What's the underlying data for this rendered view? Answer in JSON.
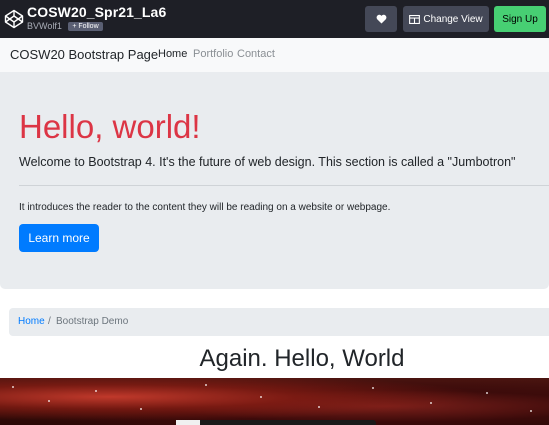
{
  "codepen": {
    "title": "COSW20_Spr21_La6",
    "username": "BVWolf1",
    "follow_label": "+ Follow",
    "change_view_label": "Change View",
    "signup_label": "Sign Up"
  },
  "navbar": {
    "brand": "COSW20 Bootstrap Page",
    "links": [
      {
        "label": "Home"
      },
      {
        "label": "Portfolio"
      },
      {
        "label": "Contact"
      }
    ]
  },
  "jumbotron": {
    "title": "Hello, world!",
    "lead": "Welcome to Bootstrap 4. It's the future of web design. This section is called a \"Jumbotron\"",
    "text": "It introduces the reader to the content they will be reading on a website or webpage.",
    "button_label": "Learn more"
  },
  "breadcrumb": {
    "home": "Home",
    "separator": "/",
    "current": "Bootstrap Demo"
  },
  "section_heading": "Again. Hello, World",
  "colors": {
    "accent_red": "#dc3545",
    "primary_blue": "#007bff",
    "signup_green": "#47cf73"
  }
}
